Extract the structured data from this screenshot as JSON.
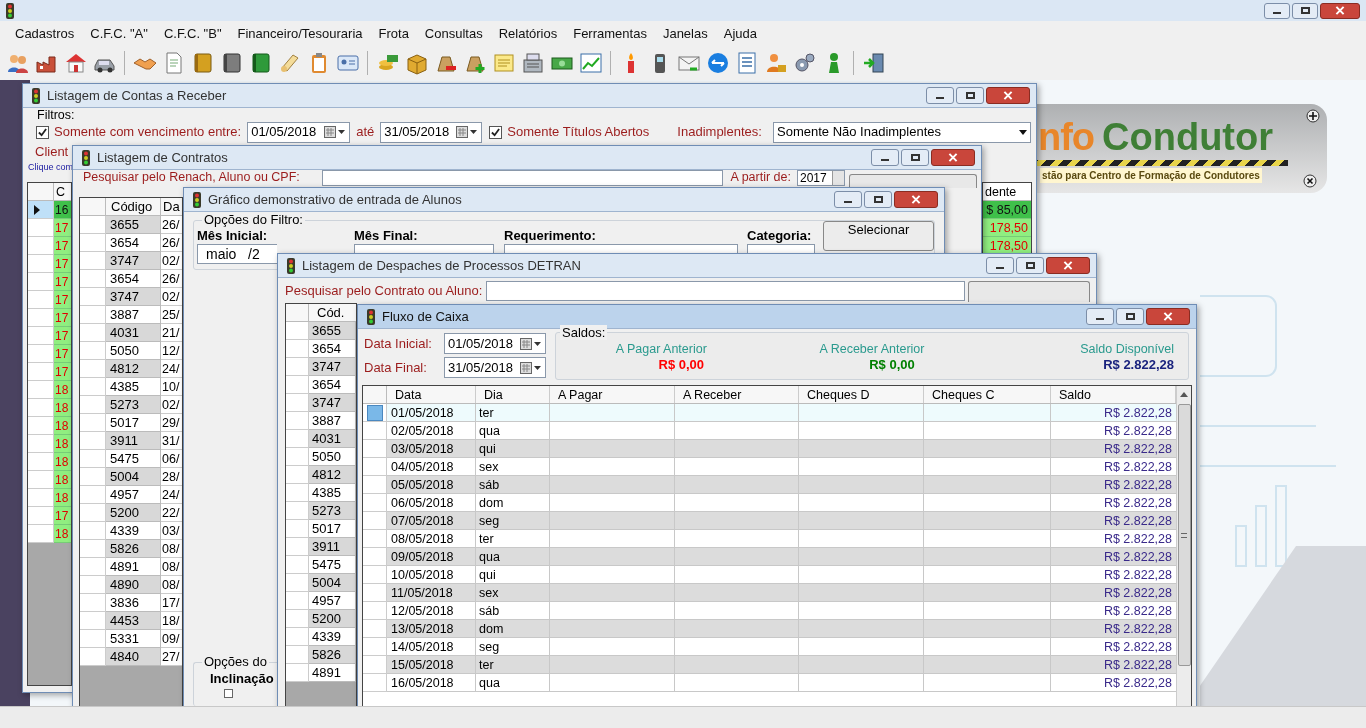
{
  "menu": [
    "Cadastros",
    "C.F.C. \"A\"",
    "C.F.C. \"B\"",
    "Financeiro/Tesouraria",
    "Frota",
    "Consultas",
    "Relatórios",
    "Ferramentas",
    "Janelas",
    "Ajuda"
  ],
  "logo": {
    "name_start": "nfo",
    "name_end": "Condutor",
    "tagline": "stão para Centro de Formação de Condutores"
  },
  "contas_a_receber": {
    "title": "Listagem de Contas a Receber",
    "active": false,
    "filters_label": "Filtros:",
    "due_filter": {
      "label": "Somente com vencimento entre:",
      "checked": true
    },
    "date_from": "01/05/2018",
    "between_label": "até",
    "date_to": "31/05/2018",
    "open_filter": {
      "label": "Somente Títulos Abertos",
      "checked": true
    },
    "defaulters_label": "Inadimplentes:",
    "defaulters_value": "Somente Não Inadimplentes",
    "client_label": "Client",
    "hint": "Clique com",
    "columns": [
      "C",
      "dente"
    ],
    "rows": [
      {
        "code": "16",
        "amount": "$ 85,00",
        "selected": true
      },
      {
        "code": "17",
        "amount": "178,50",
        "selected": false
      },
      {
        "code": "17",
        "amount": "178,50",
        "selected": false
      },
      {
        "code": "17",
        "selected": false
      },
      {
        "code": "17",
        "selected": false
      },
      {
        "code": "17",
        "selected": false
      },
      {
        "code": "17",
        "selected": false
      },
      {
        "code": "17",
        "selected": false
      },
      {
        "code": "17",
        "selected": false
      },
      {
        "code": "17",
        "selected": false
      },
      {
        "code": "18",
        "selected": false
      },
      {
        "code": "18",
        "selected": false
      },
      {
        "code": "18",
        "selected": false
      },
      {
        "code": "18",
        "selected": false
      },
      {
        "code": "18",
        "selected": false
      },
      {
        "code": "18",
        "selected": false
      },
      {
        "code": "18",
        "selected": false
      },
      {
        "code": "17",
        "selected": false
      },
      {
        "code": "18",
        "selected": false
      }
    ]
  },
  "contratos": {
    "title": "Listagem de Contratos",
    "active": false,
    "search_label": "Pesquisar pelo Renach, Aluno ou CPF:",
    "from_label": "A partir de:",
    "year": "2017",
    "columns": [
      "Código",
      "Da"
    ],
    "rows": [
      {
        "code": "3655",
        "date": "26/"
      },
      {
        "code": "3654",
        "date": "26/"
      },
      {
        "code": "3747",
        "date": "02/"
      },
      {
        "code": "3654",
        "date": "26/"
      },
      {
        "code": "3747",
        "date": "02/"
      },
      {
        "code": "3887",
        "date": "25/"
      },
      {
        "code": "4031",
        "date": "21/"
      },
      {
        "code": "5050",
        "date": "12/"
      },
      {
        "code": "4812",
        "date": "24/"
      },
      {
        "code": "4385",
        "date": "10/"
      },
      {
        "code": "5273",
        "date": "02/"
      },
      {
        "code": "5017",
        "date": "29/"
      },
      {
        "code": "3911",
        "date": "31/"
      },
      {
        "code": "5475",
        "date": "06/"
      },
      {
        "code": "5004",
        "date": "28/"
      },
      {
        "code": "4957",
        "date": "24/"
      },
      {
        "code": "5200",
        "date": "22/"
      },
      {
        "code": "4339",
        "date": "03/"
      },
      {
        "code": "5826",
        "date": "08/"
      },
      {
        "code": "4891",
        "date": "08/"
      },
      {
        "code": "4890",
        "date": "08/"
      },
      {
        "code": "3836",
        "date": "17/"
      },
      {
        "code": "4453",
        "date": "18/"
      },
      {
        "code": "5331",
        "date": "09/"
      },
      {
        "code": "4840",
        "date": "27/"
      }
    ]
  },
  "grafico": {
    "title": "Gráfico demonstrativo de entrada de Alunos",
    "active": false,
    "filter_group": "Opções do Filtro:",
    "start_month_label": "Mês Inicial:",
    "start_month": "maio   /2",
    "end_month_label": "Mês Final:",
    "requirement_label": "Requerimento:",
    "category_label": "Categoria:",
    "select_button": "Selecionar",
    "chart_options_label": "Opções do",
    "tilt_label": "Inclinação",
    "tilt_checked": false
  },
  "despaches": {
    "title": "Listagem de Despaches de Processos DETRAN",
    "active": false,
    "search_label": "Pesquisar pelo Contrato ou Aluno:",
    "columns": [
      "Cód."
    ],
    "rows": [
      "3655",
      "3654",
      "3747",
      "3654",
      "3747",
      "3887",
      "4031",
      "5050",
      "4812",
      "4385",
      "5273",
      "5017",
      "3911",
      "5475",
      "5004",
      "4957",
      "5200",
      "4339",
      "5826",
      "4891"
    ]
  },
  "fluxo_de_caixa": {
    "title": "Fluxo de Caixa",
    "active": true,
    "start_label": "Data Inicial:",
    "start_date": "01/05/2018",
    "end_label": "Data Final:",
    "end_date": "31/05/2018",
    "balances_label": "Saldos:",
    "balances": [
      {
        "label": "A Pagar Anterior",
        "value": "R$ 0,00",
        "color": "#ff0000"
      },
      {
        "label": "A Receber Anterior",
        "value": "R$ 0,00",
        "color": "#008000"
      },
      {
        "label": "Saldo Disponível",
        "value": "R$ 2.822,28",
        "color": "#1a237e"
      }
    ],
    "columns": [
      "Data",
      "Dia",
      "A Pagar",
      "A Receber",
      "Cheques D",
      "Cheques C",
      "Saldo"
    ],
    "rows": [
      {
        "date": "01/05/2018",
        "weekday": "ter",
        "balance": "R$ 2.822,28",
        "selected": true
      },
      {
        "date": "02/05/2018",
        "weekday": "qua",
        "balance": "R$ 2.822,28",
        "selected": false
      },
      {
        "date": "03/05/2018",
        "weekday": "qui",
        "balance": "R$ 2.822,28",
        "selected": false
      },
      {
        "date": "04/05/2018",
        "weekday": "sex",
        "balance": "R$ 2.822,28",
        "selected": false
      },
      {
        "date": "05/05/2018",
        "weekday": "sáb",
        "balance": "R$ 2.822,28",
        "selected": false
      },
      {
        "date": "06/05/2018",
        "weekday": "dom",
        "balance": "R$ 2.822,28",
        "selected": false
      },
      {
        "date": "07/05/2018",
        "weekday": "seg",
        "balance": "R$ 2.822,28",
        "selected": false
      },
      {
        "date": "08/05/2018",
        "weekday": "ter",
        "balance": "R$ 2.822,28",
        "selected": false
      },
      {
        "date": "09/05/2018",
        "weekday": "qua",
        "balance": "R$ 2.822,28",
        "selected": false
      },
      {
        "date": "10/05/2018",
        "weekday": "qui",
        "balance": "R$ 2.822,28",
        "selected": false
      },
      {
        "date": "11/05/2018",
        "weekday": "sex",
        "balance": "R$ 2.822,28",
        "selected": false
      },
      {
        "date": "12/05/2018",
        "weekday": "sáb",
        "balance": "R$ 2.822,28",
        "selected": false
      },
      {
        "date": "13/05/2018",
        "weekday": "dom",
        "balance": "R$ 2.822,28",
        "selected": false
      },
      {
        "date": "14/05/2018",
        "weekday": "seg",
        "balance": "R$ 2.822,28",
        "selected": false
      },
      {
        "date": "15/05/2018",
        "weekday": "ter",
        "balance": "R$ 2.822,28",
        "selected": false
      },
      {
        "date": "16/05/2018",
        "weekday": "qua",
        "balance": "R$ 2.822,28",
        "selected": false
      }
    ]
  }
}
